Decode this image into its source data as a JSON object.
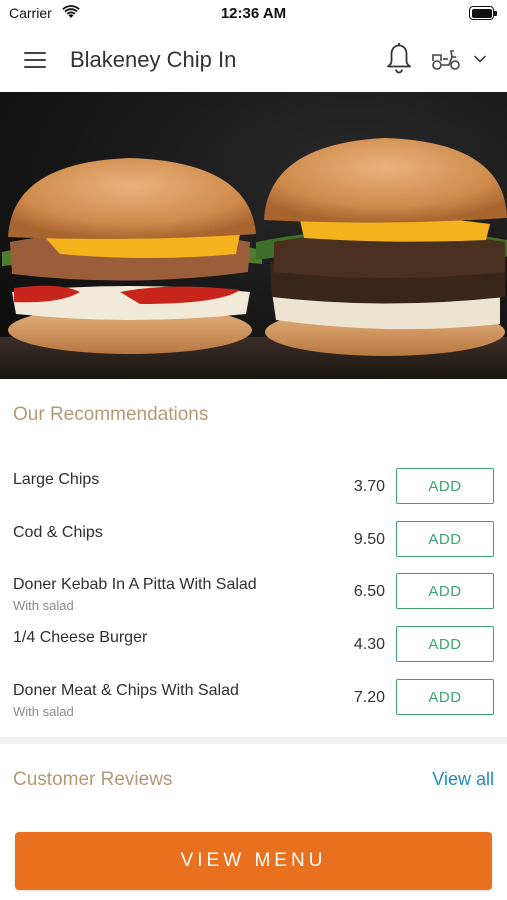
{
  "status_bar": {
    "carrier": "Carrier",
    "time": "12:36 AM"
  },
  "header": {
    "title": "Blakeney Chip In",
    "icons": [
      "menu-icon",
      "bell-icon",
      "scooter-icon",
      "chevron-down-icon"
    ]
  },
  "hero": {
    "image": "burgers-photo"
  },
  "recommendations": {
    "title": "Our Recommendations",
    "items": [
      {
        "name": "Large Chips",
        "subtitle": "",
        "price": "3.70",
        "button": "ADD"
      },
      {
        "name": "Cod & Chips",
        "subtitle": "",
        "price": "9.50",
        "button": "ADD"
      },
      {
        "name": "Doner Kebab In A Pitta With Salad",
        "subtitle": "With salad",
        "price": "6.50",
        "button": "ADD"
      },
      {
        "name": "1/4 Cheese Burger",
        "subtitle": "",
        "price": "4.30",
        "button": "ADD"
      },
      {
        "name": "Doner Meat & Chips With Salad",
        "subtitle": "With salad",
        "price": "7.20",
        "button": "ADD"
      }
    ]
  },
  "reviews": {
    "title": "Customer Reviews",
    "view_all": "View all"
  },
  "footer": {
    "view_menu": "VIEW MENU"
  },
  "colors": {
    "accent_orange": "#e8701f",
    "add_green": "#3ea36d",
    "section_title": "#b39a76",
    "link_blue": "#1d8dc2"
  }
}
